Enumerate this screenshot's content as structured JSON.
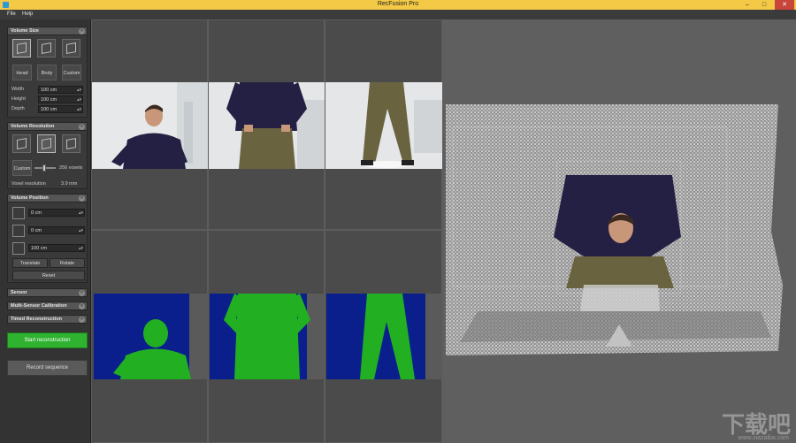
{
  "window": {
    "title": "RecFusion Pro"
  },
  "menu": [
    "File",
    "Help"
  ],
  "volume_size": {
    "header": "Volume Size",
    "presets": [
      "Head",
      "Body",
      "Custom"
    ],
    "width_label": "Width",
    "width_value": "100 cm",
    "height_label": "Height",
    "height_value": "100 cm",
    "depth_label": "Depth",
    "depth_value": "100 cm"
  },
  "volume_resolution": {
    "header": "Volume Resolution",
    "custom_label": "Custom",
    "voxels_value": "256 voxels",
    "voxel_res_label": "Voxel resolution",
    "voxel_res_value": "3.9 mm",
    "slider_fraction": 0.45
  },
  "volume_position": {
    "header": "Volume Position",
    "x_value": "0 cm",
    "y_value": "0 cm",
    "z_value": "100 cm",
    "translate_label": "Translate",
    "rotate_label": "Rotate",
    "reset_label": "Reset"
  },
  "sensor": {
    "header": "Sensor"
  },
  "multi_sensor": {
    "header": "Multi-Sensor Calibration"
  },
  "timed": {
    "header": "Timed Reconstruction"
  },
  "actions": {
    "start_label": "Start reconstruction",
    "record_label": "Record sequence"
  },
  "watermark": {
    "logo_text": "下载吧",
    "url": "www.xiazaiba.com"
  },
  "colors": {
    "titlebar": "#f3c945",
    "start": "#2fb22f",
    "depth_bg": "#0a1f8c",
    "depth_body": "#22b022",
    "view_bg": "#5f5f5f"
  }
}
